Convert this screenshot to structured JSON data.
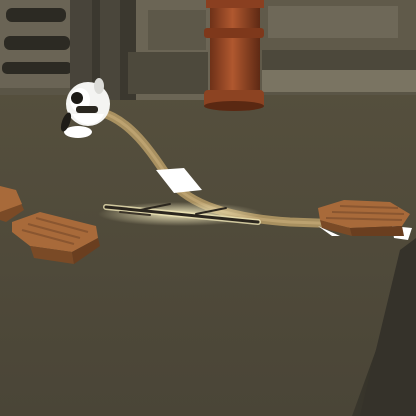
{
  "scene": {
    "description_hidden": "",
    "palette": {
      "floor": "#4f4a3b",
      "floor_dark": "#3c382d",
      "wall": "#5b5646",
      "wall_dark": "#3a362c",
      "pipe": "#9a4a2a",
      "pipe_dark": "#6e3118",
      "crate": "#a86a3a",
      "crate_dark": "#7a4a26",
      "path_line": "#b59a6a",
      "highlight": "#ffffff",
      "stick": "#2b261e",
      "stick_glow": "#e8e0b0"
    },
    "objects": [
      "wall-panels",
      "copper-pipe",
      "white-creature",
      "path-line",
      "wooden-crate-left",
      "wooden-crate-right",
      "wooden-stick"
    ]
  }
}
